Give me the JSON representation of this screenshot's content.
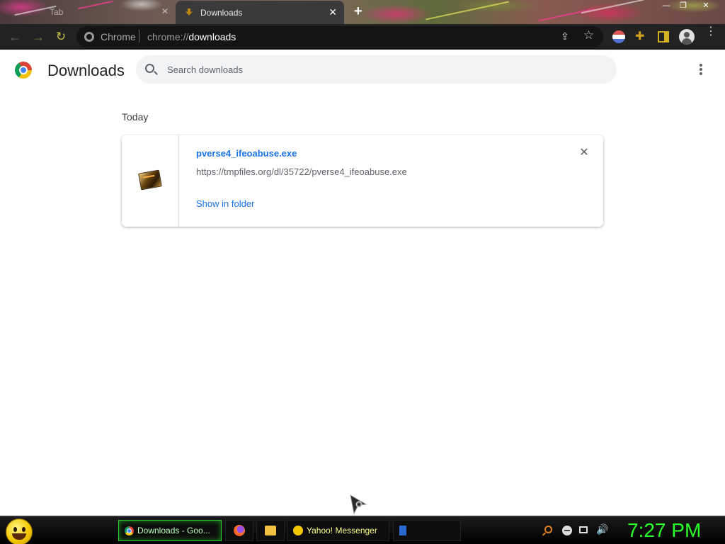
{
  "window": {
    "tabs": [
      {
        "label": "Tab",
        "active": false
      },
      {
        "label": "Downloads",
        "active": true
      }
    ],
    "new_tab_label": "+",
    "close_glyph": "✕",
    "min_glyph": "—",
    "max_glyph": "❐"
  },
  "toolbar": {
    "site_chip": "Chrome",
    "url_prefix": "chrome://",
    "url_host": "downloads",
    "icons": [
      "back-icon",
      "forward-icon",
      "reload-icon",
      "share-icon",
      "star-icon",
      "extension-flag-icon",
      "puzzle-icon",
      "side-panel-icon",
      "profile-icon",
      "menu-icon"
    ],
    "share_glyph": "⇪",
    "star_glyph": "☆",
    "puzzle_glyph": "✚",
    "back_glyph": "←",
    "forward_glyph": "→",
    "reload_glyph": "↻"
  },
  "downloads_page": {
    "title": "Downloads",
    "search_placeholder": "Search downloads",
    "section_date": "Today",
    "items": [
      {
        "file_name": "pverse4_ifeoabuse.exe",
        "url": "https://tmpfiles.org/dl/35722/pverse4_ifeoabuse.exe",
        "action_label": "Show in folder",
        "remove_glyph": "✕"
      }
    ]
  },
  "taskbar": {
    "tasks": [
      {
        "label": "Downloads - Goo...",
        "icon": "chrome-icon",
        "active": true
      },
      {
        "label": "",
        "icon": "firefox-icon"
      },
      {
        "label": "",
        "icon": "explorer-icon"
      },
      {
        "label": "Yahoo! Messenger",
        "icon": "yahoo-messenger-icon"
      },
      {
        "label": "",
        "icon": "app-icon"
      }
    ],
    "tray_icons": [
      "search-icon",
      "minus-circle-icon",
      "network-icon",
      "volume-icon"
    ],
    "volume_glyph": "🔊",
    "clock": "7:27 PM"
  },
  "colors": {
    "link_blue": "#1a73e8",
    "clock_green": "#2aff2a",
    "active_task_green": "#2ad02a"
  }
}
